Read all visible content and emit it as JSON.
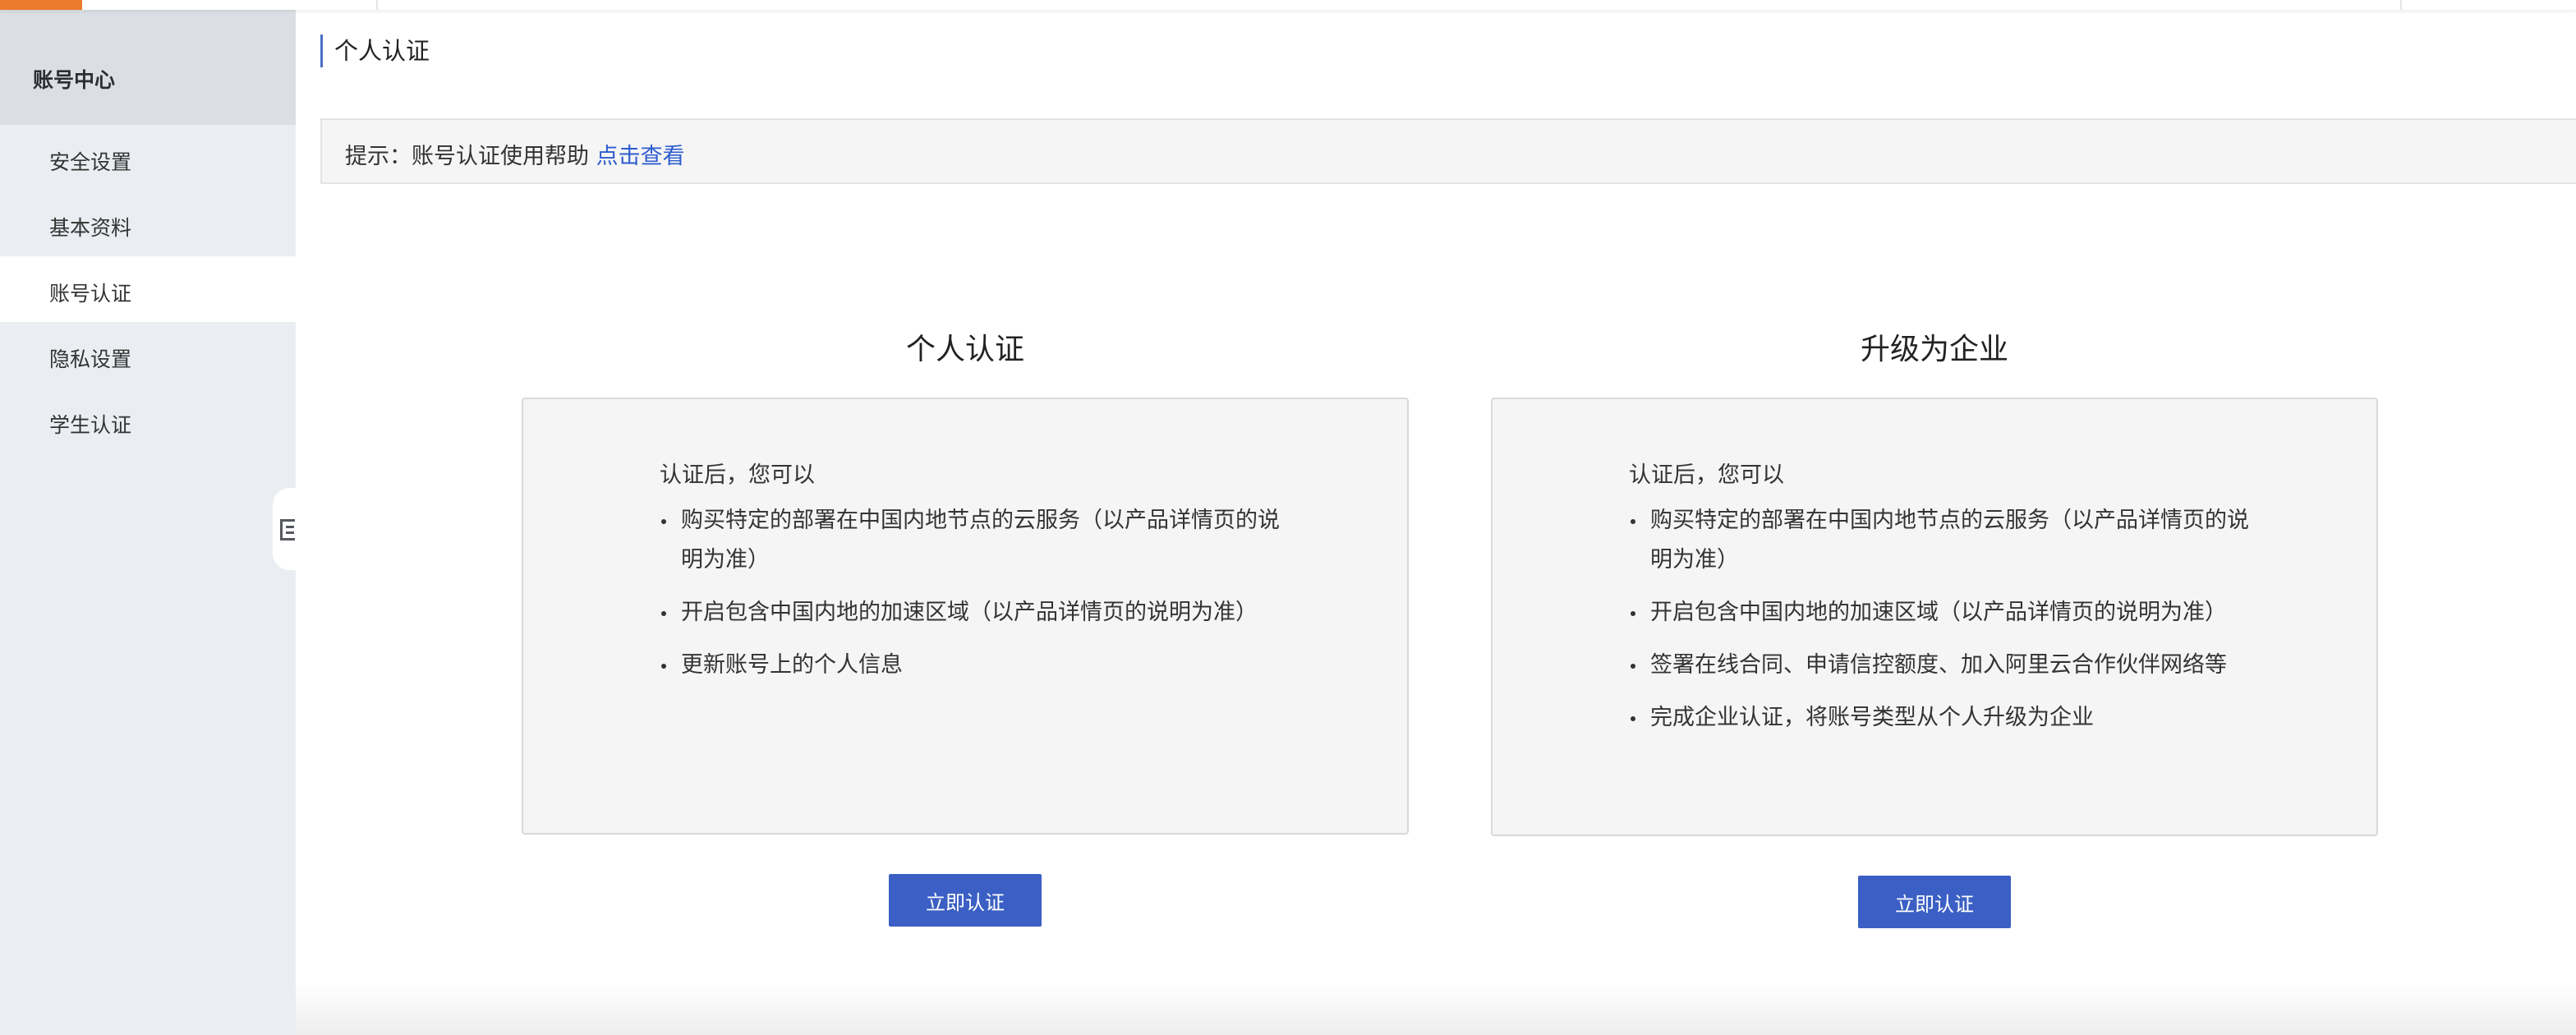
{
  "sidebar": {
    "title": "账号中心",
    "items": [
      {
        "label": "安全设置"
      },
      {
        "label": "基本资料"
      },
      {
        "label": "账号认证"
      },
      {
        "label": "隐私设置"
      },
      {
        "label": "学生认证"
      }
    ],
    "active_item": "账号认证"
  },
  "page": {
    "heading": "个人认证"
  },
  "tip": {
    "prefix": "提示：账号认证使用帮助",
    "link": "点击查看"
  },
  "cards": [
    {
      "title": "个人认证",
      "intro": "认证后，您可以",
      "items": [
        "购买特定的部署在中国内地节点的云服务（以产品详情页的说明为准）",
        "开启包含中国内地的加速区域（以产品详情页的说明为准）",
        "更新账号上的个人信息"
      ],
      "button": "立即认证"
    },
    {
      "title": "升级为企业",
      "intro": "认证后，您可以",
      "items": [
        "购买特定的部署在中国内地节点的云服务（以产品详情页的说明为准）",
        "开启包含中国内地的加速区域（以产品详情页的说明为准）",
        "签署在线合同、申请信控额度、加入阿里云合作伙伴网络等",
        "完成企业认证，将账号类型从个人升级为企业"
      ],
      "button": "立即认证"
    }
  ],
  "colors": {
    "brand_orange": "#ec7a2d",
    "primary_button": "#3b5fc4",
    "link": "#2d5ccf",
    "sidebar_bg": "#eaedf1"
  },
  "icons": {
    "collapse": "sidebar-collapse-icon"
  }
}
